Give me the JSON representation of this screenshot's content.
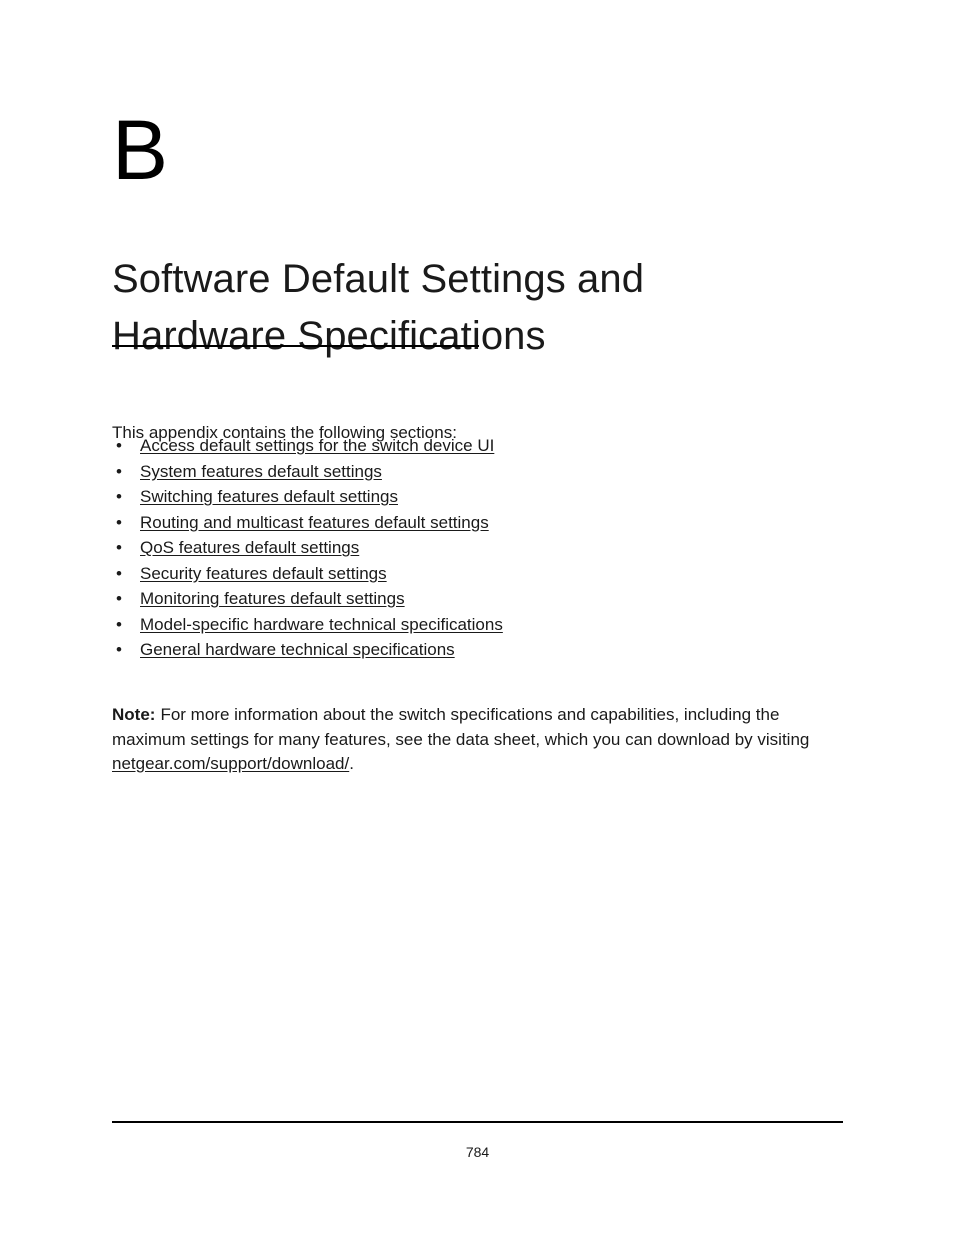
{
  "document": {
    "chapter_letter": "B",
    "title_lines": [
      "Software Default Settings and",
      "Hardware Specifications"
    ],
    "intro": "This appendix contains the following sections:",
    "sections": [
      {
        "label": "Access default settings for the switch device UI"
      },
      {
        "label": "System features default settings"
      },
      {
        "label": "Switching features default settings"
      },
      {
        "label": "Routing and multicast features default settings"
      },
      {
        "label": "QoS features default settings"
      },
      {
        "label": "Security features default settings"
      },
      {
        "label": "Monitoring features default settings"
      },
      {
        "label": "Model-specific hardware technical specifications"
      },
      {
        "label": "General hardware technical specifications"
      }
    ],
    "note": {
      "label": "Note:",
      "text_before_link": "For more information about the switch specifications and capabilities, including the maximum settings for many features, see the data sheet, which you can download by visiting ",
      "link_text": "netgear.com/support/download/",
      "text_after_link": "."
    },
    "footer": {
      "page_number": "784"
    }
  }
}
